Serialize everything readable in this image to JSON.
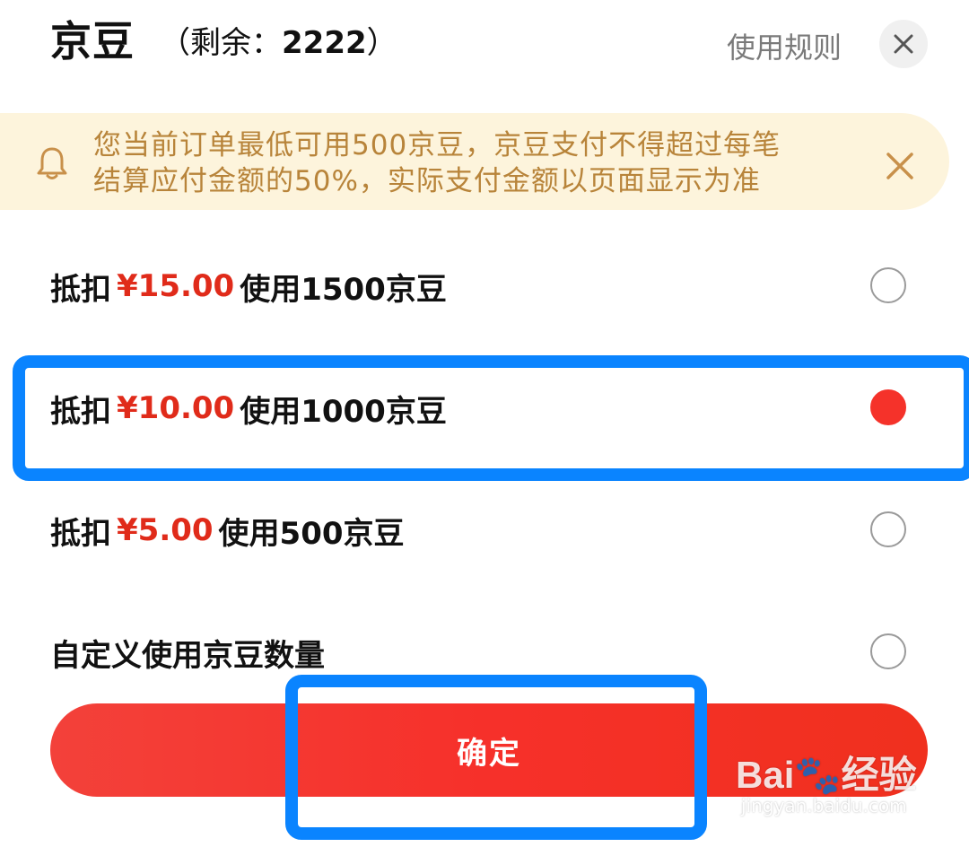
{
  "header": {
    "title": "京豆",
    "remaining_prefix": "（剩余：",
    "remaining_value": "2222",
    "remaining_suffix": "）",
    "rules_link": "使用规则",
    "close_icon": "close-icon"
  },
  "notice": {
    "icon": "bell-icon",
    "line1": "您当前订单最低可用500京豆，京豆支付不得超过每笔",
    "line2": "结算应付金额的50%，实际支付金额以页面显示为准",
    "dismiss_icon": "close-icon"
  },
  "options": [
    {
      "prefix": "抵扣",
      "amount": "¥15.00",
      "suffix": "使用1500京豆",
      "checked": false
    },
    {
      "prefix": "抵扣",
      "amount": "¥10.00",
      "suffix": "使用1000京豆",
      "checked": true
    },
    {
      "prefix": "抵扣",
      "amount": "¥5.00",
      "suffix": "使用500京豆",
      "checked": false
    },
    {
      "label": "自定义使用京豆数量",
      "checked": false
    }
  ],
  "confirm_label": "确定",
  "watermark": {
    "brand": "Bai🐾经验",
    "url": "jingyan.baidu.com"
  },
  "colors": {
    "accent": "#f5322a",
    "amount": "#e02b1a",
    "notice_bg": "#fdf4dc",
    "notice_text": "#b8843a",
    "highlight": "#0a84ff"
  }
}
